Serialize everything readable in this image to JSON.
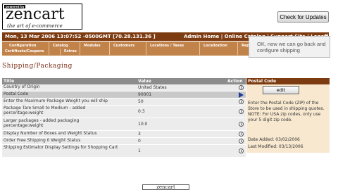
{
  "logo": {
    "powered": "powered by",
    "brand": "zencart",
    "tagline": "the art of e-commerce"
  },
  "check_updates": "Check for Updates",
  "header": {
    "datetime": "Mon, 13 Mar 2006 13:07:52 -0500GMT [70.28.131.36 ]",
    "links": "Admin Home | Online Catalog | Support Site | Logoff"
  },
  "menu": {
    "row1": [
      "Configuration",
      "Catalog",
      "Modules",
      "Customers",
      "Locations / Taxes",
      "Localization",
      "Reports"
    ],
    "row2": [
      "Certificate/Coupons",
      "Extras"
    ]
  },
  "tooltip": "OK, now we can go back and configure shipping",
  "page_title": "Shipping/Packaging",
  "table": {
    "headers": {
      "title": "Title",
      "value": "Value",
      "action": "Action"
    },
    "rows": [
      {
        "title": "Country of Origin",
        "value": "United States",
        "action": "info"
      },
      {
        "title": "Postal Code",
        "value": "90001",
        "action": "selected"
      },
      {
        "title": "Enter the Maximum Package Weight you will ship",
        "value": "50",
        "action": "info"
      },
      {
        "title": "Package Tare Small to Medium - added percentage:weight",
        "value": "0:3",
        "action": "info"
      },
      {
        "title": "Larger packages - added packaging percentage:weight",
        "value": "10:0",
        "action": "info"
      },
      {
        "title": "Display Number of Boxes and Weight Status",
        "value": "3",
        "action": "info"
      },
      {
        "title": "Order Free Shipping 0 Weight Status",
        "value": "0",
        "action": "info"
      },
      {
        "title": "Shipping Estimator Display Settings for Shopping Cart",
        "value": "1",
        "action": "info"
      }
    ]
  },
  "panel": {
    "title": "Postal Code",
    "edit_label": "edit",
    "description": "Enter the Postal Code (ZIP) of the Store to be used in shipping quotes. NOTE: For USA zip codes, only use your 5 digit zip code.",
    "date_added": "Date Added: 03/02/2006",
    "last_modified": "Last Modified: 03/13/2006"
  },
  "footer_logo": "zencart"
}
